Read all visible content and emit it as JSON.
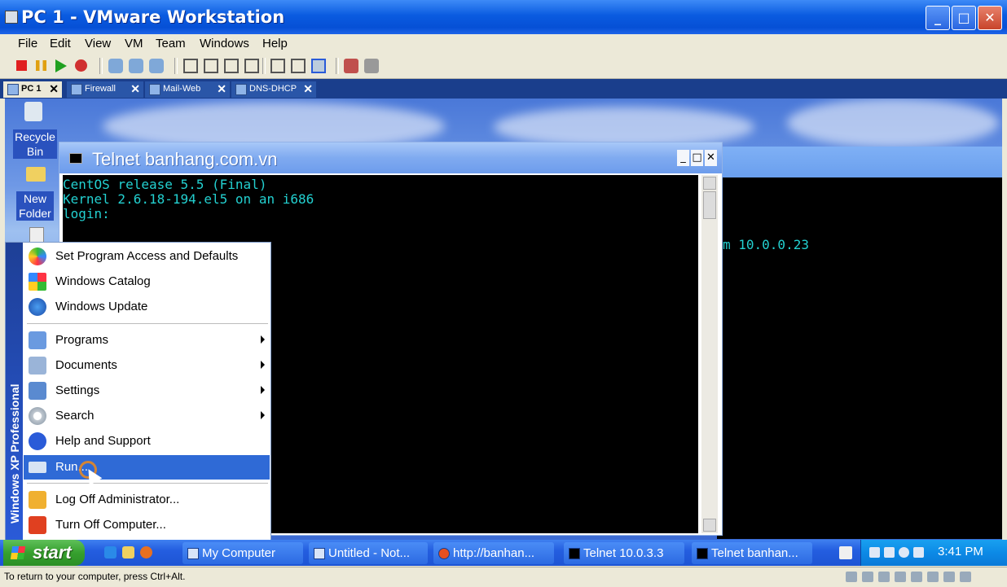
{
  "window": {
    "title": "PC 1 - VMware Workstation",
    "min_label": "_",
    "max_label": "□",
    "close_label": "✕"
  },
  "menubar": [
    "File",
    "Edit",
    "View",
    "VM",
    "Team",
    "Windows",
    "Help"
  ],
  "tabs": [
    {
      "label": "PC 1",
      "active": true
    },
    {
      "label": "Firewall",
      "active": false
    },
    {
      "label": "Mail-Web",
      "active": false
    },
    {
      "label": "DNS-DHCP",
      "active": false
    }
  ],
  "tab_close": "✕",
  "desktop": {
    "icons": [
      {
        "label": "Recycle Bin",
        "icon": "recycle-bin-icon"
      },
      {
        "label": "New Folder",
        "icon": "folder-icon"
      }
    ]
  },
  "telnet_front": {
    "title": "Telnet banhang.com.vn",
    "lines": [
      "CentOS release 5.5 (Final)",
      "Kernel 2.6.18-194.el5 on an i686",
      "login:"
    ],
    "min": "_",
    "max": "□",
    "close": "✕"
  },
  "telnet_back": {
    "visible_text": "m 10.0.0.23"
  },
  "start_menu": {
    "band_text": "Windows XP  Professional",
    "items": [
      {
        "label": "Set Program Access and Defaults",
        "icon": "program-access-icon",
        "submenu": false
      },
      {
        "label": "Windows Catalog",
        "icon": "windows-catalog-icon",
        "submenu": false
      },
      {
        "label": "Windows Update",
        "icon": "windows-update-icon",
        "submenu": false
      },
      {
        "label": "Programs",
        "icon": "programs-icon",
        "submenu": true
      },
      {
        "label": "Documents",
        "icon": "documents-icon",
        "submenu": true
      },
      {
        "label": "Settings",
        "icon": "settings-icon",
        "submenu": true
      },
      {
        "label": "Search",
        "icon": "search-icon",
        "submenu": true
      },
      {
        "label": "Help and Support",
        "icon": "help-icon",
        "submenu": false
      },
      {
        "label": "Run...",
        "icon": "run-icon",
        "submenu": false,
        "highlighted": true
      },
      {
        "label": "Log Off Administrator...",
        "icon": "log-off-icon",
        "submenu": false
      },
      {
        "label": "Turn Off Computer...",
        "icon": "power-icon",
        "submenu": false
      }
    ]
  },
  "taskbar": {
    "start_label": "start",
    "tasks": [
      "My Computer",
      "Untitled - Not...",
      "http://banhan...",
      "Telnet 10.0.3.3",
      "Telnet banhan..."
    ],
    "clock": "3:41 PM"
  },
  "status": {
    "text": "To return to your computer, press Ctrl+Alt."
  },
  "colors": {
    "titlebar": "#0a5be0",
    "console_text": "#23d0d0",
    "highlight": "#2f6ad6",
    "start_button": "#36a02e"
  }
}
